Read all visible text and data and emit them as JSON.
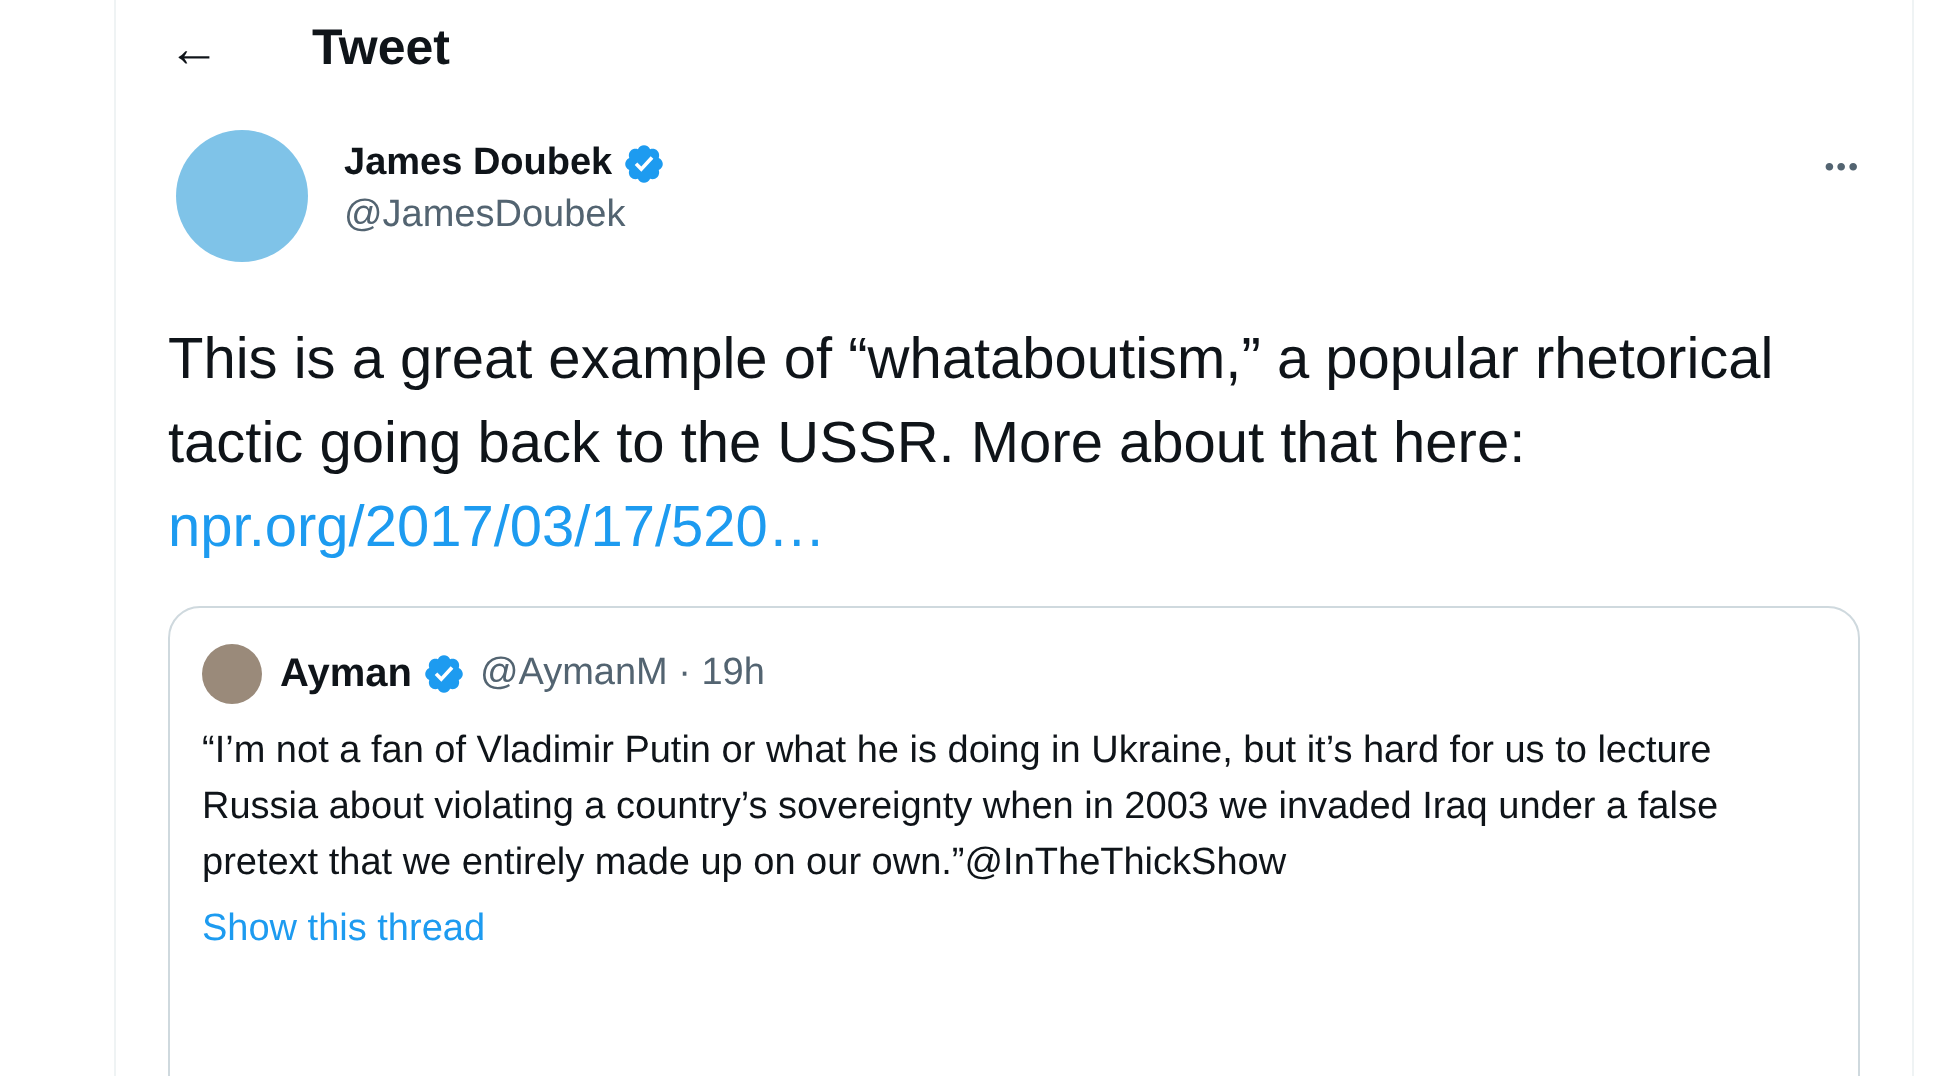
{
  "header": {
    "back_icon": "←",
    "title": "Tweet"
  },
  "author": {
    "name": "James Doubek",
    "verified": true,
    "handle": "@JamesDoubek",
    "more": "•••"
  },
  "tweet": {
    "text": "This is a great example of “whataboutism,” a popular rhetorical tactic going back to the USSR. More about that here: ",
    "link": "npr.org/2017/03/17/520…"
  },
  "quoted_tweet": {
    "name": "Ayman",
    "verified": true,
    "handle": "@AymanM",
    "separator": "·",
    "time": "19h",
    "text": "“I’m not a fan of Vladimir Putin or what he is doing in Ukraine, but it’s hard for us to lecture Russia about violating a country’s sovereignty when in 2003 we invaded Iraq under a false pretext that we entirely made up on our own.”@InTheThickShow",
    "thread_link": "Show this thread"
  }
}
